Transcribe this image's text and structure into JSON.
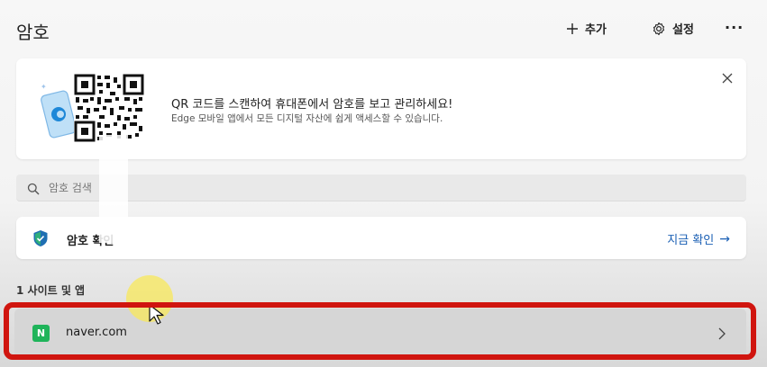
{
  "header": {
    "title": "암호",
    "add_label": "추가",
    "settings_label": "설정",
    "more_label": "···"
  },
  "qr_banner": {
    "title": "QR 코드를 스캔하여 휴대폰에서 암호를 보고 관리하세요!",
    "description": "Edge 모바일 앱에서 모든 디지털 자산에 쉽게 액세스할 수 있습니다."
  },
  "search": {
    "placeholder": "암호 검색"
  },
  "password_check": {
    "label": "암호 확인",
    "action_label": "지금 확인"
  },
  "sites": {
    "section_title": "1 사이트 및 앱",
    "items": [
      {
        "favicon_letter": "N",
        "name": "naver.com"
      }
    ]
  },
  "colors": {
    "accent_link": "#1a5fb4",
    "naver_green": "#1fb45a",
    "highlight_red": "#d0150f"
  }
}
